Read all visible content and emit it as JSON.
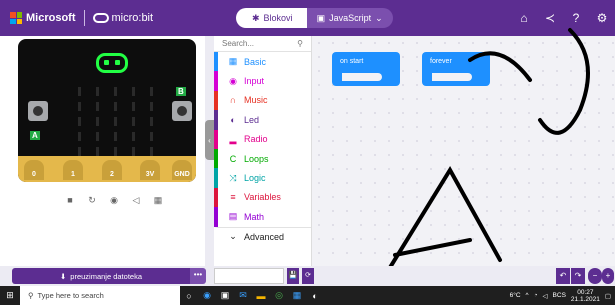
{
  "header": {
    "brand": "Microsoft",
    "product": "micro:bit",
    "tab_blocks": "Blokovi",
    "tab_js": "JavaScript",
    "icons": [
      "home-icon",
      "share-icon",
      "help-icon",
      "settings-icon"
    ]
  },
  "simulator": {
    "pins": [
      "0",
      "1",
      "2",
      "3V",
      "GND"
    ],
    "button_a": "A",
    "button_b": "B",
    "tools": [
      "stop-icon",
      "restart-icon",
      "slowmo-icon",
      "mute-icon",
      "screenshot-icon"
    ]
  },
  "toolbox": {
    "search_placeholder": "Search...",
    "categories": [
      {
        "label": "Basic",
        "color": "#1e90ff",
        "icon": "grid-icon"
      },
      {
        "label": "Input",
        "color": "#d400d4",
        "icon": "circle-icon"
      },
      {
        "label": "Music",
        "color": "#e63022",
        "icon": "headphones-icon"
      },
      {
        "label": "Led",
        "color": "#5c2d91",
        "icon": "toggle-icon"
      },
      {
        "label": "Radio",
        "color": "#e3008c",
        "icon": "signal-icon"
      },
      {
        "label": "Loops",
        "color": "#00aa00",
        "icon": "loop-icon"
      },
      {
        "label": "Logic",
        "color": "#00a4a6",
        "icon": "shuffle-icon"
      },
      {
        "label": "Variables",
        "color": "#dc143c",
        "icon": "list-icon"
      },
      {
        "label": "Math",
        "color": "#9400d3",
        "icon": "calculator-icon"
      }
    ],
    "advanced": "Advanced"
  },
  "workspace": {
    "block_on_start": "on start",
    "block_forever": "forever"
  },
  "bottom": {
    "download": "preuzimanje datoteka",
    "more": "•••",
    "project_name": "",
    "save": "💾",
    "github": "⟳",
    "undo": "↶",
    "redo": "↷",
    "zoom_out": "−",
    "zoom_in": "+"
  },
  "taskbar": {
    "search_placeholder": "Type here to search",
    "weather": "6°C",
    "language": "BCS",
    "time": "00:27",
    "date": "21.1.2021"
  }
}
